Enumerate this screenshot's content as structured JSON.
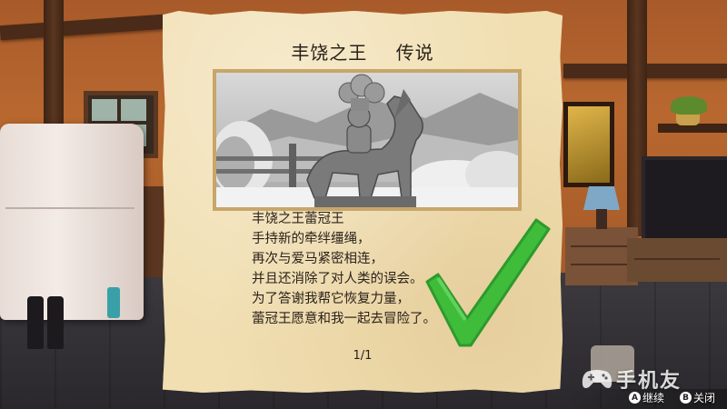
{
  "legend": {
    "title_main": "丰饶之王",
    "title_sub": "传说",
    "illustration": {
      "icon": "glastrier-statue-illustration",
      "tone": "sepia-grayscale"
    },
    "story_lines": [
      "丰饶之王蕾冠王",
      "手持新的牵绊缰绳，",
      "再次与爱马紧密相连，",
      "并且还消除了对人类的误会。",
      "为了答谢我帮它恢复力量，",
      "蕾冠王愿意和我一起去冒险了。"
    ],
    "page_indicator": "1/1",
    "completion_mark": "check-icon"
  },
  "controls": {
    "continue": {
      "glyph": "A",
      "label": "继续"
    },
    "close": {
      "glyph": "B",
      "label": "关闭"
    }
  },
  "watermark": {
    "text": "手机友",
    "icon": "gamepad-icon"
  },
  "colors": {
    "parchment": "#f1dfb2",
    "check_green": "#3ebc3a",
    "text": "#2a221a",
    "frame": "#c8a66a"
  }
}
